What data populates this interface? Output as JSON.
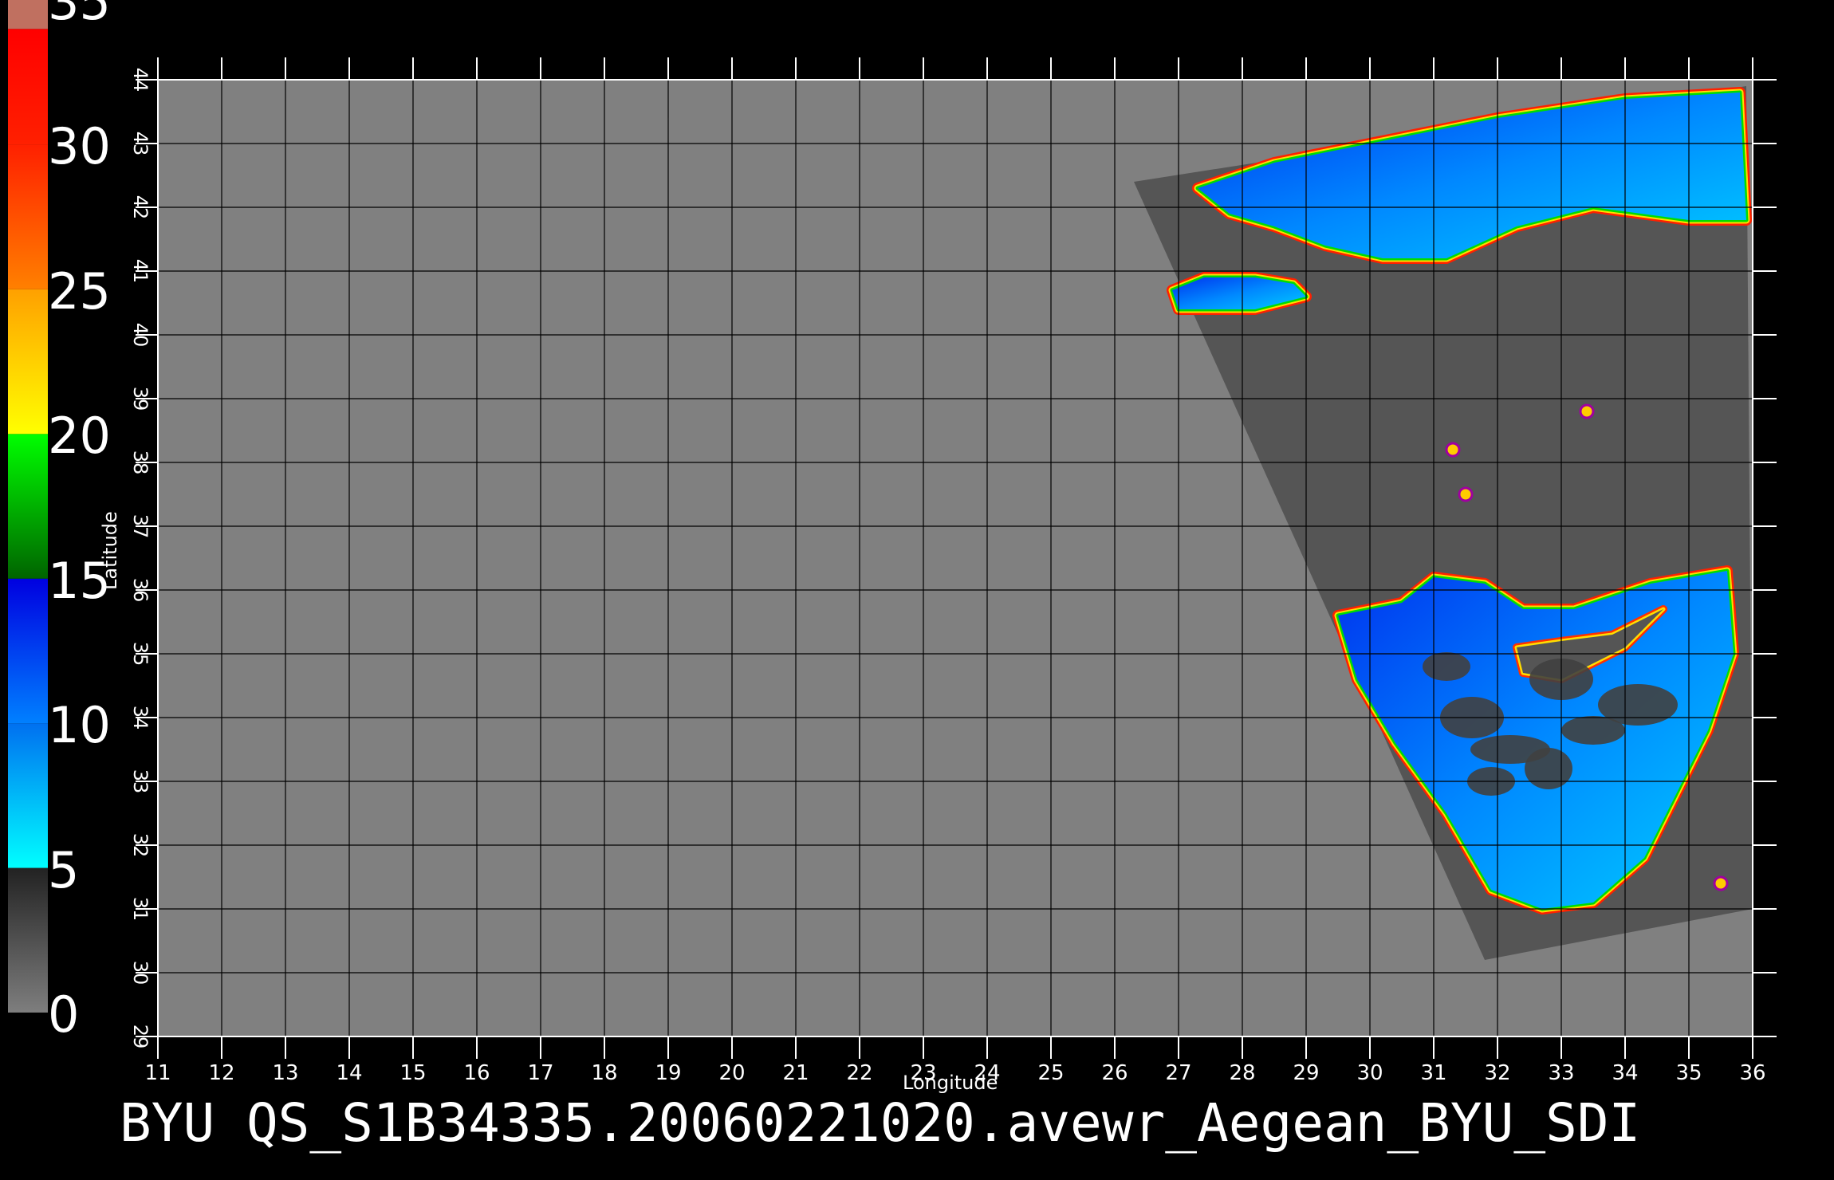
{
  "title": "BYU  QS_S1B34335.20060221020.avewr_Aegean_BYU_SDI",
  "colorbar": {
    "ticks": [
      "35",
      "30",
      "25",
      "20",
      "15",
      "10",
      "5",
      "0"
    ],
    "segments": [
      {
        "from": 0,
        "to": 5,
        "color": [
          "#7e7e7e",
          "#222222"
        ]
      },
      {
        "from": 5,
        "to": 10,
        "color": [
          "#00ffff",
          "#0070f0"
        ]
      },
      {
        "from": 10,
        "to": 15,
        "color": [
          "#0080ff",
          "#0000e0"
        ]
      },
      {
        "from": 15,
        "to": 20,
        "color": [
          "#006400",
          "#00ff00"
        ]
      },
      {
        "from": 20,
        "to": 25,
        "color": [
          "#ffff00",
          "#ffa000"
        ]
      },
      {
        "from": 25,
        "to": 30,
        "color": [
          "#ff8000",
          "#ff2000"
        ]
      },
      {
        "from": 30,
        "to": 34,
        "color": [
          "#ff2000",
          "#ff0000"
        ]
      },
      {
        "from": 34,
        "to": 35,
        "color": [
          "#c07060",
          "#c07060"
        ]
      }
    ]
  },
  "axes": {
    "xlabel": "Longitude",
    "ylabel": "Latitude",
    "lon_range": [
      11,
      36
    ],
    "lat_range": [
      29,
      44
    ],
    "lon_ticks": [
      "11",
      "12",
      "13",
      "14",
      "15",
      "16",
      "17",
      "18",
      "19",
      "20",
      "21",
      "22",
      "23",
      "24",
      "25",
      "26",
      "27",
      "28",
      "29",
      "30",
      "31",
      "32",
      "33",
      "34",
      "35",
      "36"
    ],
    "lat_ticks": [
      "29",
      "30",
      "31",
      "32",
      "33",
      "34",
      "35",
      "36",
      "37",
      "38",
      "39",
      "40",
      "41",
      "42",
      "43",
      "44"
    ],
    "grid": true
  },
  "colors": {
    "background": "#000000",
    "map_fill": "#808080",
    "swath_fill": "#555555",
    "grid": "#000000"
  },
  "features": {
    "swath_corners_lonlat": [
      [
        26.3,
        42.4
      ],
      [
        35.9,
        43.9
      ],
      [
        36.0,
        31.0
      ],
      [
        31.8,
        30.2
      ]
    ],
    "north_coast_lonlat": [
      [
        27.3,
        42.3
      ],
      [
        28.5,
        42.7
      ],
      [
        30,
        43.0
      ],
      [
        32,
        43.4
      ],
      [
        34,
        43.7
      ],
      [
        35.8,
        43.8
      ],
      [
        35.9,
        41.8
      ],
      [
        35,
        41.8
      ],
      [
        33.5,
        42.0
      ],
      [
        32.3,
        41.7
      ],
      [
        31.2,
        41.2
      ],
      [
        30.2,
        41.2
      ],
      [
        29.3,
        41.4
      ],
      [
        28.5,
        41.7
      ],
      [
        27.8,
        41.9
      ]
    ],
    "marmara_lonlat": [
      [
        26.9,
        40.7
      ],
      [
        27.4,
        40.9
      ],
      [
        28.2,
        40.9
      ],
      [
        28.8,
        40.8
      ],
      [
        29.0,
        40.6
      ],
      [
        28.2,
        40.4
      ],
      [
        27.6,
        40.4
      ],
      [
        27.0,
        40.4
      ]
    ],
    "south_sea_lonlat": [
      [
        29.5,
        35.6
      ],
      [
        30.5,
        35.8
      ],
      [
        31.0,
        36.2
      ],
      [
        31.8,
        36.1
      ],
      [
        32.4,
        35.7
      ],
      [
        33.2,
        35.7
      ],
      [
        34.4,
        36.1
      ],
      [
        35.6,
        36.3
      ],
      [
        35.7,
        35.0
      ],
      [
        35.3,
        33.8
      ],
      [
        34.8,
        32.8
      ],
      [
        34.3,
        31.8
      ],
      [
        33.5,
        31.1
      ],
      [
        32.7,
        31.0
      ],
      [
        31.9,
        31.3
      ],
      [
        31.2,
        32.5
      ],
      [
        30.4,
        33.6
      ],
      [
        29.8,
        34.6
      ]
    ],
    "cyprus_lonlat": [
      [
        32.3,
        35.1
      ],
      [
        33.0,
        35.2
      ],
      [
        33.8,
        35.3
      ],
      [
        34.6,
        35.7
      ],
      [
        34.0,
        35.1
      ],
      [
        33.0,
        34.6
      ],
      [
        32.4,
        34.7
      ]
    ],
    "small_islands_lonlat": [
      [
        33.4,
        38.8
      ],
      [
        31.3,
        38.2
      ],
      [
        31.5,
        37.5
      ],
      [
        35.5,
        31.4
      ]
    ]
  }
}
